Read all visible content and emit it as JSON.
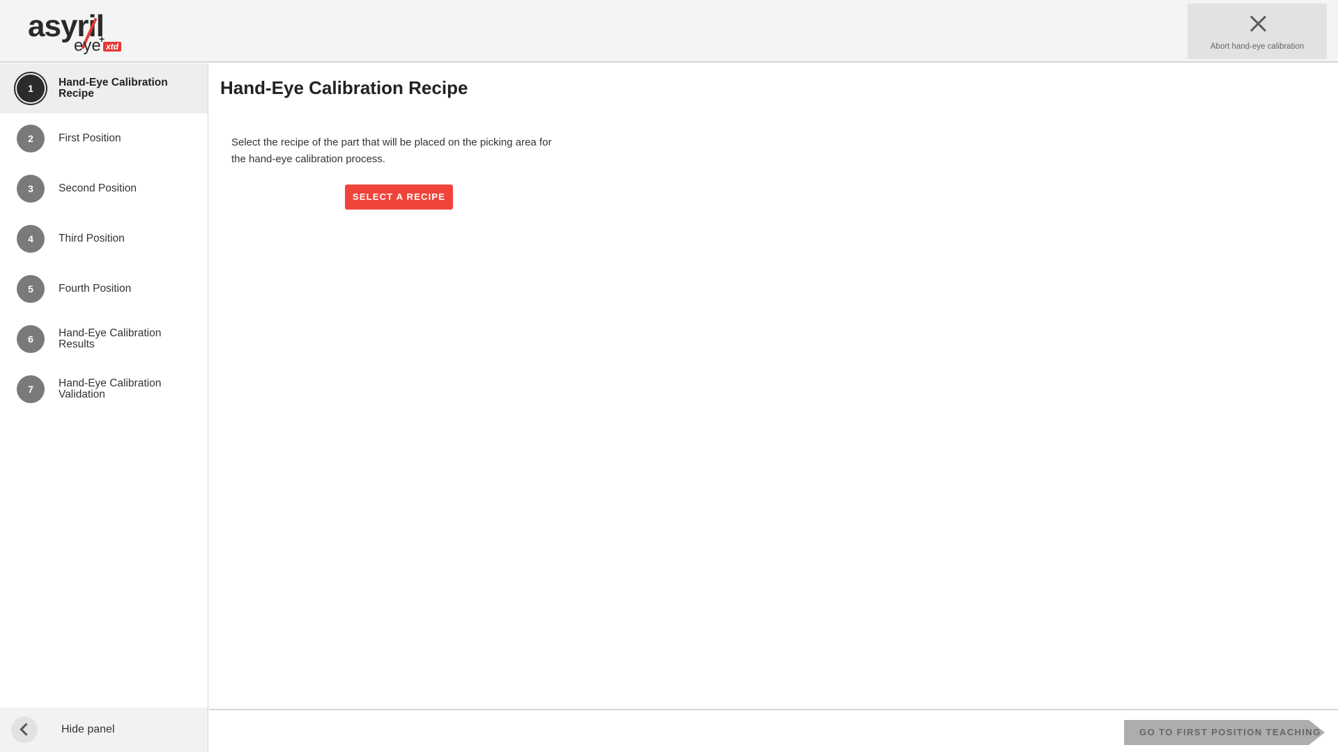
{
  "header": {
    "logo": {
      "word": "asyril",
      "sub": "eye",
      "plus": "+",
      "badge": "xtd"
    },
    "abort_label": "Abort hand-eye calibration"
  },
  "sidebar": {
    "steps": [
      {
        "number": "1",
        "label": "Hand-Eye Calibration Recipe",
        "active": true
      },
      {
        "number": "2",
        "label": "First Position",
        "active": false
      },
      {
        "number": "3",
        "label": "Second Position",
        "active": false
      },
      {
        "number": "4",
        "label": "Third Position",
        "active": false
      },
      {
        "number": "5",
        "label": "Fourth Position",
        "active": false
      },
      {
        "number": "6",
        "label": "Hand-Eye Calibration Results",
        "active": false
      },
      {
        "number": "7",
        "label": "Hand-Eye Calibration Validation",
        "active": false
      }
    ],
    "hide_panel_label": "Hide panel"
  },
  "main": {
    "title": "Hand-Eye Calibration Recipe",
    "description": "Select the recipe of the part that will be placed on the picking area for the hand-eye calibration process.",
    "select_button": "SELECT A RECIPE"
  },
  "footer": {
    "next_button": "GO TO FIRST POSITION TEACHING"
  },
  "colors": {
    "accent": "#f0443a",
    "active_step": "#2b2b2b",
    "inactive_step": "#7a7a7a",
    "disabled_button": "#adadad"
  }
}
